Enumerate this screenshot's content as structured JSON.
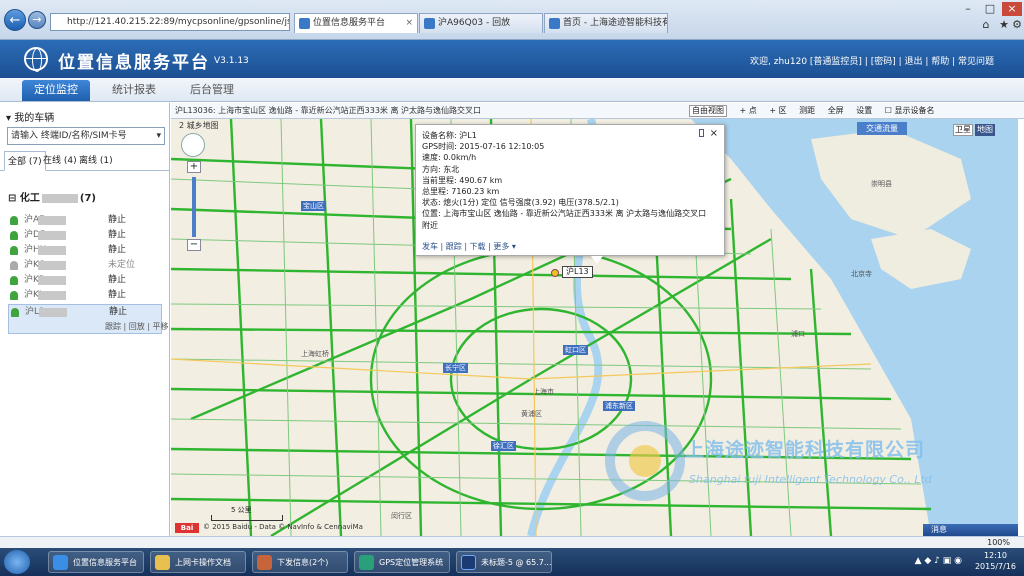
{
  "browser": {
    "address": "http://121.40.215.22:89/mycpsonline/gpsonline/jsp",
    "tabs": [
      {
        "label": "位置信息服务平台",
        "active": true
      },
      {
        "label": "沪A96Q03 - 回放",
        "active": false
      },
      {
        "label": "首页 - 上海途迹智能科技有限...",
        "active": false
      }
    ]
  },
  "header": {
    "title": "位置信息服务平台",
    "version": "V3.1.13",
    "user_links": "欢迎, zhu120 [普通监控员] | [密码] | 退出 | 帮助 | 常见问题"
  },
  "nav": {
    "tabs": [
      {
        "label": "定位监控",
        "active": true
      },
      {
        "label": "统计报表",
        "active": false
      },
      {
        "label": "后台管理",
        "active": false
      }
    ]
  },
  "sidebar": {
    "title": "我的车辆",
    "search_placeholder": "请输入 终端ID/名称/SIM卡号",
    "filter_tabs": [
      {
        "label": "全部 (7)",
        "active": true
      },
      {
        "label": "在线 (4)",
        "active": false
      },
      {
        "label": "离线 (1)",
        "active": false
      }
    ],
    "group": "化工",
    "group_count": "(7)",
    "vehicles": [
      {
        "name": "沪AE",
        "status": "静止",
        "selected": false
      },
      {
        "name": "沪DF",
        "status": "静止",
        "selected": false
      },
      {
        "name": "沪HX",
        "status": "静止",
        "selected": false
      },
      {
        "name": "沪KC",
        "status": "未定位",
        "selected": false
      },
      {
        "name": "沪KD",
        "status": "静止",
        "selected": false
      },
      {
        "name": "沪KL",
        "status": "静止",
        "selected": false
      },
      {
        "name": "沪L1",
        "status": "静止",
        "selected": true
      }
    ],
    "selected_actions": "跟踪 | 回放 | 平移"
  },
  "toolbar": {
    "address": "沪L13036: 上海市宝山区 逸仙路 - 靠近新公汽站正西333米 离 沪太路与逸仙路交叉口",
    "select_label": "自由视图",
    "items": [
      "+ 点",
      "+ 区",
      "测距",
      "全屏",
      "设置",
      "显示设备名"
    ]
  },
  "map": {
    "type_label": "2 城乡地图",
    "layer_buttons": [
      "交通流量",
      "卫星",
      "地图"
    ],
    "scale": "5 公里",
    "copyright": "© 2015 Baidu - Data © NavInfo & CennaviMa",
    "message_tab": "消息",
    "places": [
      "宝山区",
      "虹口区",
      "上海虹桥",
      "长宁区",
      "上海市",
      "黄浦区",
      "浦东新区",
      "徐汇区",
      "闵行区",
      "崇明县",
      "北京寺",
      "浦口"
    ],
    "popup": {
      "lines": [
        "设备名称: 沪L1",
        "GPS时间: 2015-07-16 12:10:05",
        "速度: 0.0km/h",
        "方向: 东北",
        "当前里程: 490.67 km",
        "总里程: 7160.23 km",
        "状态: 熄火(1分) 定位 信号强度(3.92) 电压(378.5/2.1)",
        "位置: 上海市宝山区 逸仙路 - 靠近新公汽站正西333米 离 沪太路与逸仙路交叉口",
        "附近"
      ],
      "actions": "发车 | 跟踪 | 下载 | 更多 ▾"
    },
    "vehicle_tag": "沪L13"
  },
  "watermark": {
    "company_cn": "上海途迹智能科技有限公司",
    "company_en": "Shanghai tuji Intelligent Technology Co., Ltd"
  },
  "status": {
    "zoom": "100%"
  },
  "taskbar": {
    "items": [
      "位置信息服务平台",
      "上网卡操作文档",
      "下发信息(2个)",
      "GPS定位管理系统",
      "未标题-5 @ 65.7..."
    ],
    "clock_time": "12:10",
    "clock_date": "2015/7/16"
  },
  "colors": {
    "header": "#1c4f92",
    "road": "#2fb52f",
    "water": "#a9d3ee",
    "land": "#f2eee2"
  }
}
